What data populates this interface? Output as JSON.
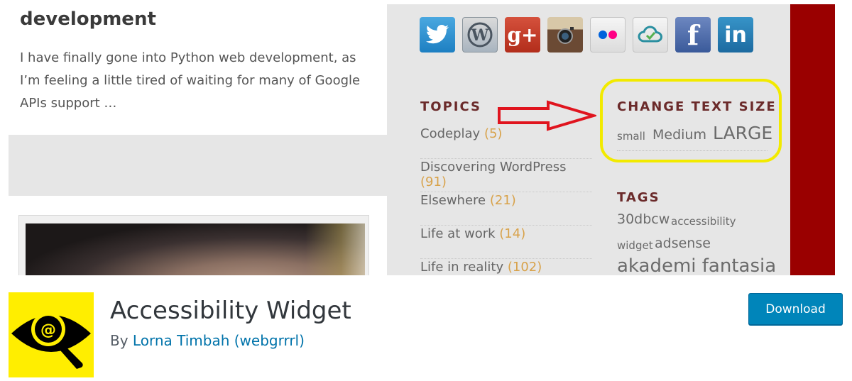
{
  "banner": {
    "post": {
      "title": "development",
      "excerpt": "I have finally gone into Python web development, as I’m feeling a little tired of waiting for many of Google APIs support …"
    },
    "social_icons": [
      "twitter-icon",
      "wordpress-icon",
      "google-plus-icon",
      "instagram-icon",
      "flickr-icon",
      "cloud-icon",
      "facebook-icon",
      "linkedin-icon"
    ],
    "topics": {
      "heading": "TOPICS",
      "items": [
        {
          "label": "Codeplay",
          "count": "(5)"
        },
        {
          "label": "Discovering WordPress",
          "count": "(91)"
        },
        {
          "label": "Elsewhere",
          "count": "(21)"
        },
        {
          "label": "Life at work",
          "count": "(14)"
        },
        {
          "label": "Life in reality",
          "count": "(102)"
        }
      ]
    },
    "text_size": {
      "heading": "CHANGE TEXT SIZE",
      "small": "small",
      "medium": "Medium",
      "large": "LARGE"
    },
    "tags": {
      "heading": "TAGS",
      "items": [
        "30dbcw",
        "accessibility",
        "widget",
        "adsense",
        "akademi fantasia"
      ]
    },
    "colors": {
      "highlight": "#f2ea00",
      "arrow": "#e0141e",
      "sidebar_accent": "#9a0000",
      "count": "#d8a24a"
    }
  },
  "plugin": {
    "name": "Accessibility Widget",
    "by": "By",
    "author": "Lorna Timbah (webgrrrl)",
    "download_label": "Download",
    "icon_color": "#ffee00",
    "button_color": "#0085ba"
  }
}
